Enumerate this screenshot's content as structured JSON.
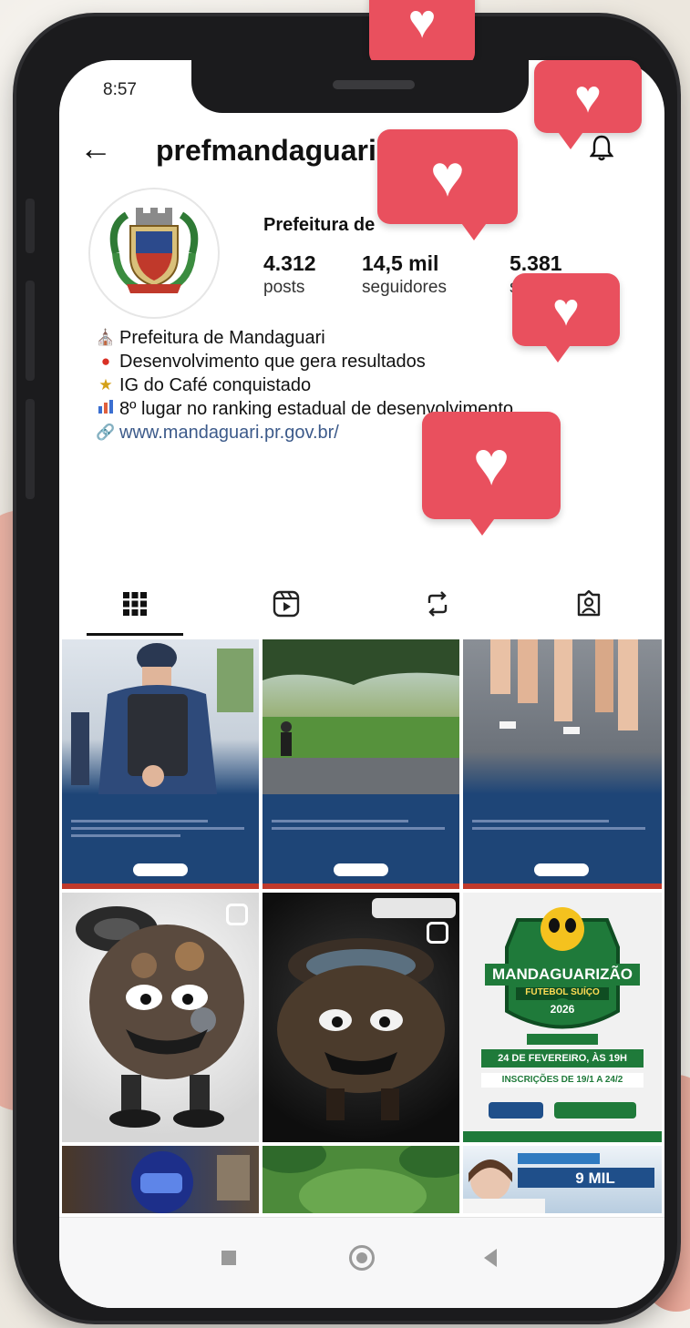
{
  "status_bar": {
    "time": "8:57"
  },
  "header": {
    "username": "prefmandaguari"
  },
  "profile": {
    "name": "Prefeitura de",
    "stats": [
      {
        "value": "4.312",
        "label": "posts"
      },
      {
        "value": "14,5 mil",
        "label": "seguidores"
      },
      {
        "value": "5.381",
        "label": "seguindo"
      }
    ]
  },
  "bio": {
    "lines": [
      {
        "icon": "government-building-icon",
        "text": "Prefeitura de Mandaguari"
      },
      {
        "icon": "pin-icon",
        "text": "Desenvolvimento que gera resultados"
      },
      {
        "icon": "trophy-icon",
        "text": "IG do Café conquistado"
      },
      {
        "icon": "bar-chart-icon",
        "text": "8º lugar no ranking estadual de desenvolvimento"
      }
    ],
    "link": "www.mandaguari.pr.gov.br/"
  },
  "tabs": [
    "grid-icon",
    "reels-icon",
    "reposts-icon",
    "tagged-icon"
  ],
  "posts": [
    {
      "type": "image",
      "description": "guard"
    },
    {
      "type": "image",
      "description": "track"
    },
    {
      "type": "image",
      "description": "runners"
    },
    {
      "type": "reel",
      "description": "tire-monster"
    },
    {
      "type": "reel",
      "description": "tire-monster-dark"
    },
    {
      "type": "image",
      "description": "futsal"
    },
    {
      "type": "image",
      "description": "welder"
    },
    {
      "type": "image",
      "description": "field"
    },
    {
      "type": "image",
      "description": "doctor"
    }
  ],
  "post_texts": {
    "futsal_title": "MANDAGUARIZÃO",
    "futsal_sub": "FUTEBOL SUÍÇO",
    "futsal_year": "2026",
    "futsal_date": "24 DE FEVEREIRO, ÀS 19H",
    "futsal_inscricoes": "INSCRIÇÕES DE 19/1 A 24/2",
    "doctor_banner": "9 MIL"
  },
  "colors": {
    "heart": "#e9505e",
    "link": "#3c5a8a",
    "post_blue": "#1e4577"
  }
}
